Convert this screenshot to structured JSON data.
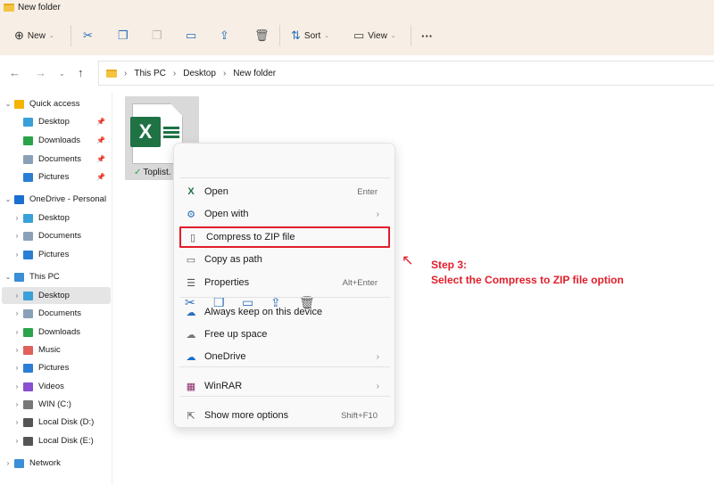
{
  "window": {
    "title": "New folder"
  },
  "toolbar": {
    "new_label": "New",
    "sort_label": "Sort",
    "view_label": "View"
  },
  "address": {
    "crumbs": [
      "This PC",
      "Desktop",
      "New folder"
    ]
  },
  "sidebar": {
    "items": [
      {
        "label": "Quick access",
        "color": "#f4b400"
      },
      {
        "label": "Desktop",
        "color": "#3aa0d8",
        "pinned": true
      },
      {
        "label": "Downloads",
        "color": "#2aa34a",
        "pinned": true
      },
      {
        "label": "Documents",
        "color": "#8aa0b8",
        "pinned": true
      },
      {
        "label": "Pictures",
        "color": "#2a7fd4",
        "pinned": true
      },
      {
        "label": "OneDrive - Personal",
        "color": "#1a6fd0"
      },
      {
        "label": "Desktop",
        "color": "#3aa0d8"
      },
      {
        "label": "Documents",
        "color": "#8aa0b8"
      },
      {
        "label": "Pictures",
        "color": "#2a7fd4"
      },
      {
        "label": "This PC",
        "color": "#3a8fd8"
      },
      {
        "label": "Desktop",
        "color": "#3aa0d8",
        "selected": true
      },
      {
        "label": "Documents",
        "color": "#8aa0b8"
      },
      {
        "label": "Downloads",
        "color": "#2aa34a"
      },
      {
        "label": "Music",
        "color": "#e0605a"
      },
      {
        "label": "Pictures",
        "color": "#2a7fd4"
      },
      {
        "label": "Videos",
        "color": "#8a4fd0"
      },
      {
        "label": "WIN (C:)",
        "color": "#777"
      },
      {
        "label": "Local Disk (D:)",
        "color": "#555"
      },
      {
        "label": "Local Disk (E:)",
        "color": "#555"
      },
      {
        "label": "Network",
        "color": "#3a8fd8"
      }
    ]
  },
  "file": {
    "name": "Toplist."
  },
  "context_menu": {
    "items": [
      {
        "label": "Open",
        "shortcut": "Enter"
      },
      {
        "label": "Open with"
      },
      {
        "label": "Compress to ZIP file"
      },
      {
        "label": "Copy as path"
      },
      {
        "label": "Properties",
        "shortcut": "Alt+Enter"
      },
      {
        "label": "Always keep on this device"
      },
      {
        "label": "Free up space"
      },
      {
        "label": "OneDrive"
      },
      {
        "label": "WinRAR"
      },
      {
        "label": "Show more options",
        "shortcut": "Shift+F10"
      }
    ]
  },
  "annotation": {
    "step": "Step 3:",
    "text": "Select the Compress to ZIP file option",
    "color": "#e11d2a"
  }
}
